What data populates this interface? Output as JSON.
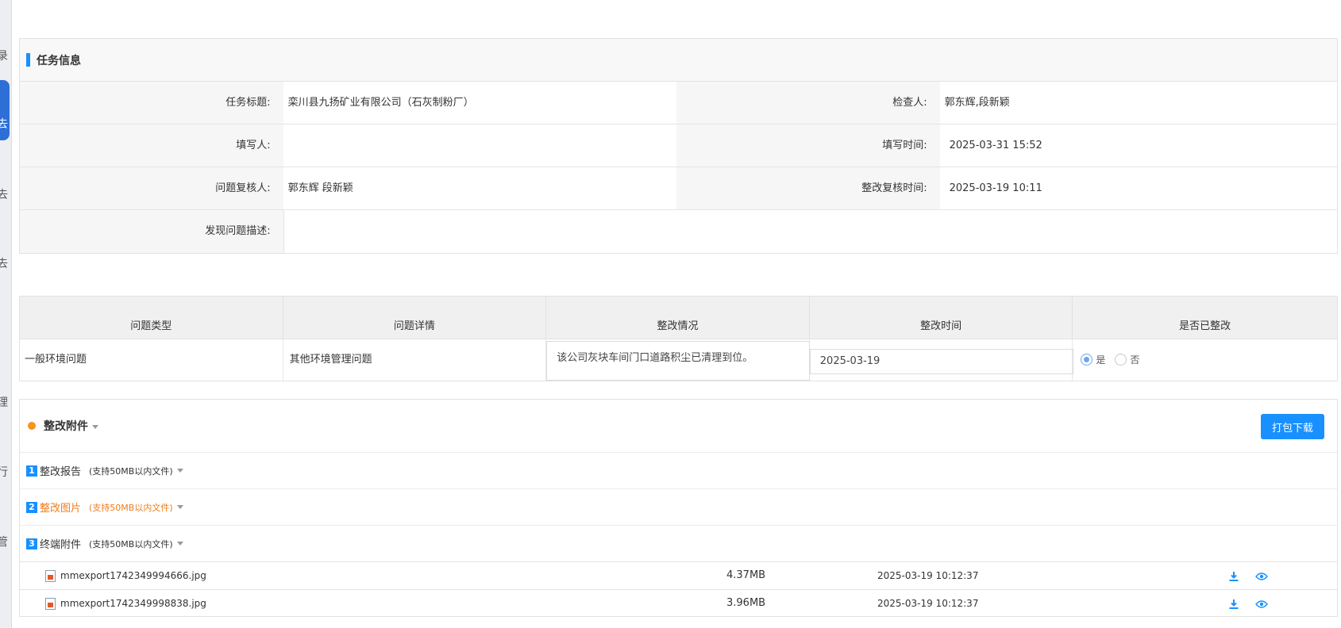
{
  "sidebar": {
    "chars": [
      "录",
      "去",
      "去",
      "理",
      "行",
      "管"
    ],
    "active_char": "去"
  },
  "task_info": {
    "header": "任务信息",
    "fields": {
      "task_title_label": "任务标题:",
      "task_title_value": "栾川县九扬矿业有限公司（石灰制粉厂）",
      "inspector_label": "检查人:",
      "inspector_value": "郭东辉,段新颖",
      "filler_label": "填写人:",
      "filler_value": "",
      "fill_time_label": "填写时间:",
      "fill_time_value": "2025-03-31 15:52",
      "reviewer_label": "问题复核人:",
      "reviewer_value": "郭东辉 段新颖",
      "review_time_label": "整改复核时间:",
      "review_time_value": "2025-03-19 10:11",
      "description_label": "发现问题描述:",
      "description_value": ""
    }
  },
  "problem_table": {
    "headers": [
      "问题类型",
      "问题详情",
      "整改情况",
      "整改时间",
      "是否已整改"
    ],
    "row": {
      "type": "一般环境问题",
      "detail": "其他环境管理问题",
      "rectification": "该公司灰块车间门口道路积尘已清理到位。",
      "date": "2025-03-19",
      "yes_label": "是",
      "no_label": "否",
      "selected": "是"
    }
  },
  "attachments": {
    "title": "整改附件",
    "pack_button": "打包下载",
    "sections": [
      {
        "num": "1",
        "name": "整改报告",
        "note": "(支持50MB以内文件)"
      },
      {
        "num": "2",
        "name": "整改图片",
        "note": "(支持50MB以内文件)"
      },
      {
        "num": "3",
        "name": "终端附件",
        "note": "(支持50MB以内文件)"
      }
    ],
    "files": [
      {
        "name": "mmexport1742349994666.jpg",
        "size": "4.37MB",
        "time": "2025-03-19 10:12:37"
      },
      {
        "name": "mmexport1742349998838.jpg",
        "size": "3.96MB",
        "time": "2025-03-19 10:12:37"
      }
    ]
  },
  "colors": {
    "accent": "#1890ff",
    "orange": "#f07c1c",
    "header_bg": "#f8f8f8"
  }
}
